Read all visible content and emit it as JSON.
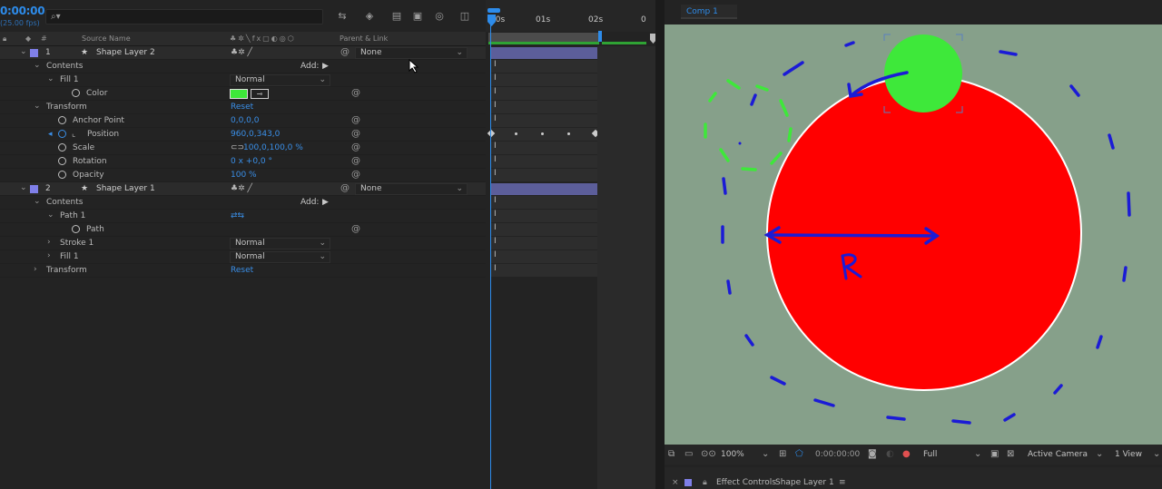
{
  "timeline": {
    "timecode": "0:00:00",
    "fps": "(25.00 fps)",
    "columns": {
      "source_name": "Source Name",
      "parent_link": "Parent & Link"
    },
    "ruler": {
      "t0": "00s",
      "t1": "01s",
      "t2": "02s",
      "t3": "0"
    },
    "rows": [
      {
        "type": "layer",
        "num": "1",
        "name": "Shape Layer 2",
        "parent": "None"
      },
      {
        "type": "group",
        "label": "Contents",
        "add": "Add:"
      },
      {
        "type": "group",
        "label": "Fill 1",
        "value": "Normal"
      },
      {
        "type": "prop",
        "label": "Color"
      },
      {
        "type": "group",
        "label": "Transform",
        "value": "Reset"
      },
      {
        "type": "prop",
        "label": "Anchor Point",
        "value": "0,0,0,0"
      },
      {
        "type": "prop",
        "label": "Position",
        "value": "960,0,343,0"
      },
      {
        "type": "prop",
        "label": "Scale",
        "value": "100,0,100,0 %"
      },
      {
        "type": "prop",
        "label": "Rotation",
        "value": "0 x +0,0 °"
      },
      {
        "type": "prop",
        "label": "Opacity",
        "value": "100 %"
      },
      {
        "type": "layer",
        "num": "2",
        "name": "Shape Layer 1",
        "parent": "None"
      },
      {
        "type": "group",
        "label": "Contents",
        "add": "Add:"
      },
      {
        "type": "group",
        "label": "Path 1"
      },
      {
        "type": "prop",
        "label": "Path"
      },
      {
        "type": "group",
        "label": "Stroke 1",
        "value": "Normal"
      },
      {
        "type": "group",
        "label": "Fill 1",
        "value": "Normal"
      },
      {
        "type": "group",
        "label": "Transform",
        "value": "Reset"
      }
    ]
  },
  "viewer": {
    "comp_tab": "Comp 1",
    "annotation": "R",
    "zoom": "100%",
    "timecode": "0:00:00:00",
    "resolution": "Full",
    "camera": "Active Camera",
    "view": "1 View"
  },
  "effect_controls": {
    "label": "Effect Controls",
    "layer": "Shape Layer 1"
  },
  "colors": {
    "accent": "#2d8ceb",
    "fill_green": "#3ee83a",
    "circle_red": "#ff0000",
    "bg_comp": "#86a08a"
  }
}
